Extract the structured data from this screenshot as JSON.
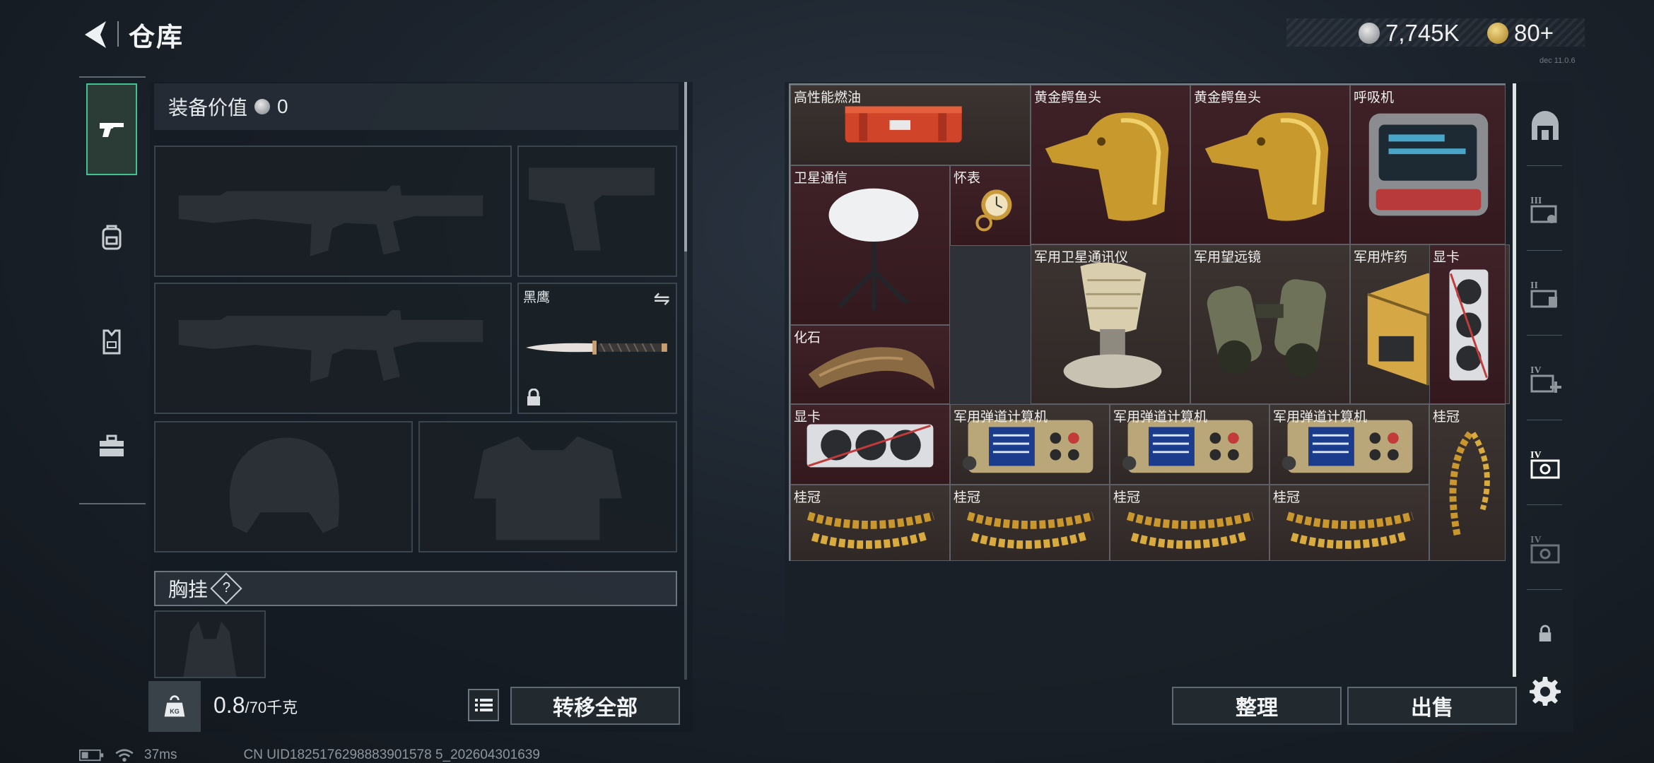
{
  "header": {
    "title": "仓库",
    "currency": [
      {
        "icon": "silver-coin-icon",
        "value": "7,745K"
      },
      {
        "icon": "gold-coin-icon",
        "value": "80+"
      }
    ],
    "version_text": "dec 11.0.6"
  },
  "left_tabs": [
    {
      "name": "weapons",
      "icon": "pistol-icon",
      "active": true
    },
    {
      "name": "backpack",
      "icon": "backpack-icon",
      "active": false
    },
    {
      "name": "vest",
      "icon": "vest-icon",
      "active": false
    },
    {
      "name": "toolbox",
      "icon": "toolbox-icon",
      "active": false
    }
  ],
  "loadout": {
    "equip_value_label": "装备价值",
    "equip_value": "0",
    "melee_label": "黑鹰",
    "chest_rig_label": "胸挂",
    "help": "?",
    "weight_value": "0.8",
    "weight_max": "/70千克",
    "weight_icon_text": "KG",
    "transfer_all": "转移全部"
  },
  "stash": {
    "accent_red": "#3f2228",
    "items": [
      {
        "id": "fuel",
        "label": "高性能燃油",
        "icon": "fuel-crate-icon"
      },
      {
        "id": "croc1",
        "label": "黄金鳄鱼头",
        "icon": "golden-crocodile-head-icon"
      },
      {
        "id": "croc2",
        "label": "黄金鳄鱼头",
        "icon": "golden-crocodile-head-icon"
      },
      {
        "id": "respirator",
        "label": "呼吸机",
        "icon": "ventilator-icon"
      },
      {
        "id": "satcom",
        "label": "卫星通信",
        "icon": "satellite-dish-icon"
      },
      {
        "id": "watch",
        "label": "怀表",
        "icon": "pocket-watch-icon"
      },
      {
        "id": "milsat",
        "label": "军用卫星通讯仪",
        "icon": "military-satellite-icon"
      },
      {
        "id": "binoculars",
        "label": "军用望远镜",
        "icon": "binoculars-icon"
      },
      {
        "id": "explosive",
        "label": "军用炸药",
        "icon": "explosive-crate-icon"
      },
      {
        "id": "gpu_v",
        "label": "显卡",
        "icon": "graphics-card-icon"
      },
      {
        "id": "fossil",
        "label": "化石",
        "icon": "fossil-claw-icon"
      },
      {
        "id": "gpu_h",
        "label": "显卡",
        "icon": "graphics-card-icon"
      },
      {
        "id": "ballistic1",
        "label": "军用弹道计算机",
        "icon": "ballistic-computer-icon"
      },
      {
        "id": "ballistic2",
        "label": "军用弹道计算机",
        "icon": "ballistic-computer-icon"
      },
      {
        "id": "ballistic3",
        "label": "军用弹道计算机",
        "icon": "ballistic-computer-icon"
      },
      {
        "id": "laurel_v",
        "label": "桂冠",
        "icon": "laurel-crown-icon"
      },
      {
        "id": "laurel1",
        "label": "桂冠",
        "icon": "laurel-crown-icon"
      },
      {
        "id": "laurel2",
        "label": "桂冠",
        "icon": "laurel-crown-icon"
      },
      {
        "id": "laurel3",
        "label": "桂冠",
        "icon": "laurel-crown-icon"
      },
      {
        "id": "laurel4",
        "label": "桂冠",
        "icon": "laurel-crown-icon"
      }
    ],
    "sort_button": "整理",
    "sell_button": "出售"
  },
  "right_tabs": [
    {
      "name": "storage-home",
      "icon": "storage-home-icon"
    },
    {
      "name": "container-III",
      "icon": "container-iii-icon",
      "roman": "III"
    },
    {
      "name": "container-II",
      "icon": "container-ii-icon",
      "roman": "II"
    },
    {
      "name": "container-IV-add",
      "icon": "container-iv-add-icon",
      "roman": "IV"
    },
    {
      "name": "container-IV-a",
      "icon": "container-iv-icon",
      "roman": "IV",
      "active": true
    },
    {
      "name": "container-IV-b",
      "icon": "container-iv-icon",
      "roman": "IV"
    },
    {
      "name": "locked",
      "icon": "lock-icon"
    },
    {
      "name": "settings",
      "icon": "gear-icon"
    }
  ],
  "status_bar": {
    "ping": "37ms",
    "uid": "CN UID1825176298883901578 5_202604301639"
  }
}
